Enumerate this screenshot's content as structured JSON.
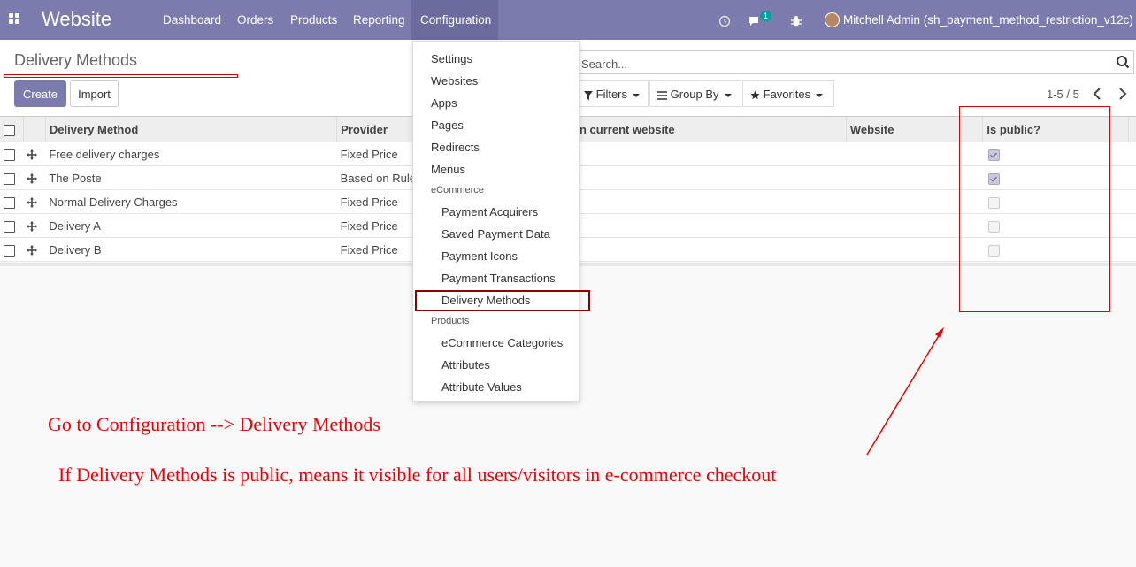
{
  "navbar": {
    "brand": "Website",
    "menu": [
      "Dashboard",
      "Orders",
      "Products",
      "Reporting",
      "Configuration"
    ],
    "active_menu": "Configuration",
    "chat_badge": "1",
    "user": "Mitchell Admin (sh_payment_method_restriction_v12c)"
  },
  "control_panel": {
    "breadcrumb": "Delivery Methods",
    "create_label": "Create",
    "import_label": "Import",
    "search_placeholder": "Search...",
    "filters_label": "Filters",
    "groupby_label": "Group By",
    "favorites_label": "Favorites",
    "pager": "1-5 / 5"
  },
  "table": {
    "columns": [
      "Delivery Method",
      "Provider",
      "n current website",
      "Website",
      "Is public?"
    ],
    "rows": [
      {
        "name": "Free delivery charges",
        "provider": "Fixed Price",
        "is_public": true
      },
      {
        "name": "The Poste",
        "provider": "Based on Rule",
        "is_public": true
      },
      {
        "name": "Normal Delivery Charges",
        "provider": "Fixed Price",
        "is_public": false
      },
      {
        "name": "Delivery A",
        "provider": "Fixed Price",
        "is_public": false
      },
      {
        "name": "Delivery B",
        "provider": "Fixed Price",
        "is_public": false
      }
    ]
  },
  "dropdown": {
    "items": [
      {
        "type": "item",
        "label": "Settings"
      },
      {
        "type": "item",
        "label": "Websites"
      },
      {
        "type": "item",
        "label": "Apps"
      },
      {
        "type": "item",
        "label": "Pages"
      },
      {
        "type": "item",
        "label": "Redirects"
      },
      {
        "type": "item",
        "label": "Menus"
      },
      {
        "type": "header",
        "label": "eCommerce"
      },
      {
        "type": "sub",
        "label": "Payment Acquirers"
      },
      {
        "type": "sub",
        "label": "Saved Payment Data"
      },
      {
        "type": "sub",
        "label": "Payment Icons"
      },
      {
        "type": "sub",
        "label": "Payment Transactions"
      },
      {
        "type": "sub",
        "label": "Delivery Methods"
      },
      {
        "type": "header",
        "label": "Products"
      },
      {
        "type": "sub",
        "label": "eCommerce Categories"
      },
      {
        "type": "sub",
        "label": "Attributes"
      },
      {
        "type": "sub",
        "label": "Attribute Values"
      }
    ]
  },
  "annotations": {
    "line1": "Go to Configuration --> Delivery Methods",
    "line2": "If Delivery Methods is public, means it visible for all users/visitors in e-commerce checkout"
  },
  "colors": {
    "navbar": "#7c7bad",
    "annotation": "#e00000"
  }
}
